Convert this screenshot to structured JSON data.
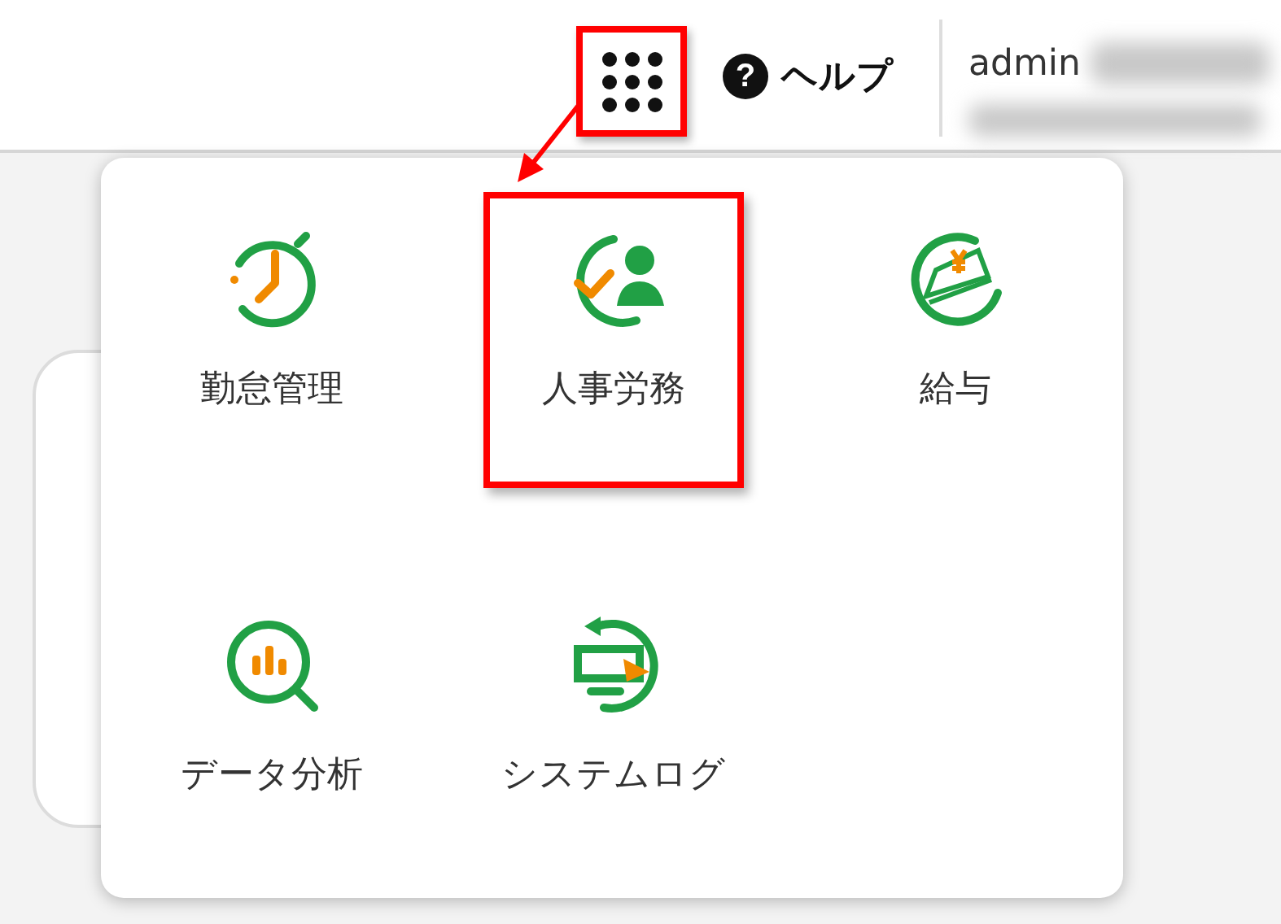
{
  "header": {
    "app_menu_button": {
      "highlighted": true
    },
    "help": {
      "icon": "?",
      "label": "ヘルプ"
    },
    "user": {
      "name": "admin"
    }
  },
  "app_menu": {
    "items": [
      {
        "kind": "attendance",
        "label": "勤怠管理",
        "highlighted": false
      },
      {
        "kind": "personnel",
        "label": "人事労務",
        "highlighted": true
      },
      {
        "kind": "payroll",
        "label": "給与",
        "highlighted": false
      },
      {
        "kind": "analytics",
        "label": "データ分析",
        "highlighted": false
      },
      {
        "kind": "log",
        "label": "システムログ",
        "highlighted": false
      }
    ]
  }
}
